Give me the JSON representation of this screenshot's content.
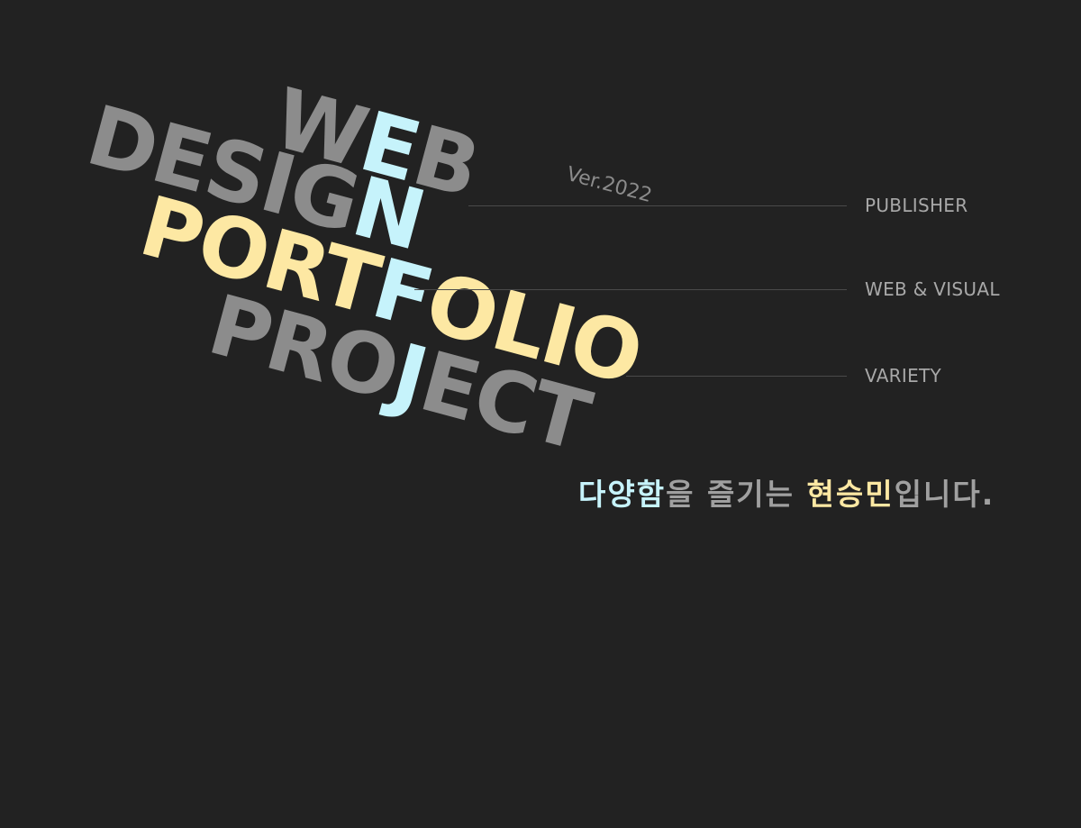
{
  "version_label": "Ver.2022",
  "headline": {
    "line1": [
      {
        "t": "W",
        "c": "gray"
      },
      {
        "t": "E",
        "c": "blue"
      },
      {
        "t": "B",
        "c": "gray"
      }
    ],
    "line2": [
      {
        "t": "DESIG",
        "c": "gray"
      },
      {
        "t": "N",
        "c": "blue"
      }
    ],
    "line3": [
      {
        "t": "PORT",
        "c": "yel"
      },
      {
        "t": "F",
        "c": "blue"
      },
      {
        "t": "OLIO",
        "c": "yel"
      }
    ],
    "line4": [
      {
        "t": "PRO",
        "c": "gray"
      },
      {
        "t": "J",
        "c": "blue"
      },
      {
        "t": "ECT",
        "c": "gray"
      }
    ]
  },
  "tags": {
    "publisher": "PUBLISHER",
    "web_visual": "WEB & VISUAL",
    "variety": "VARIETY"
  },
  "slogan": [
    {
      "t": "다양함",
      "c": "blue"
    },
    {
      "t": "을 즐기는 ",
      "c": "gray"
    },
    {
      "t": "현승민",
      "c": "yel"
    },
    {
      "t": "입니다.",
      "c": "gray"
    }
  ],
  "colors": {
    "background": "#222222",
    "gray": "#8c8c8c",
    "blue": "#c6f3fb",
    "yellow": "#fde8a3"
  }
}
